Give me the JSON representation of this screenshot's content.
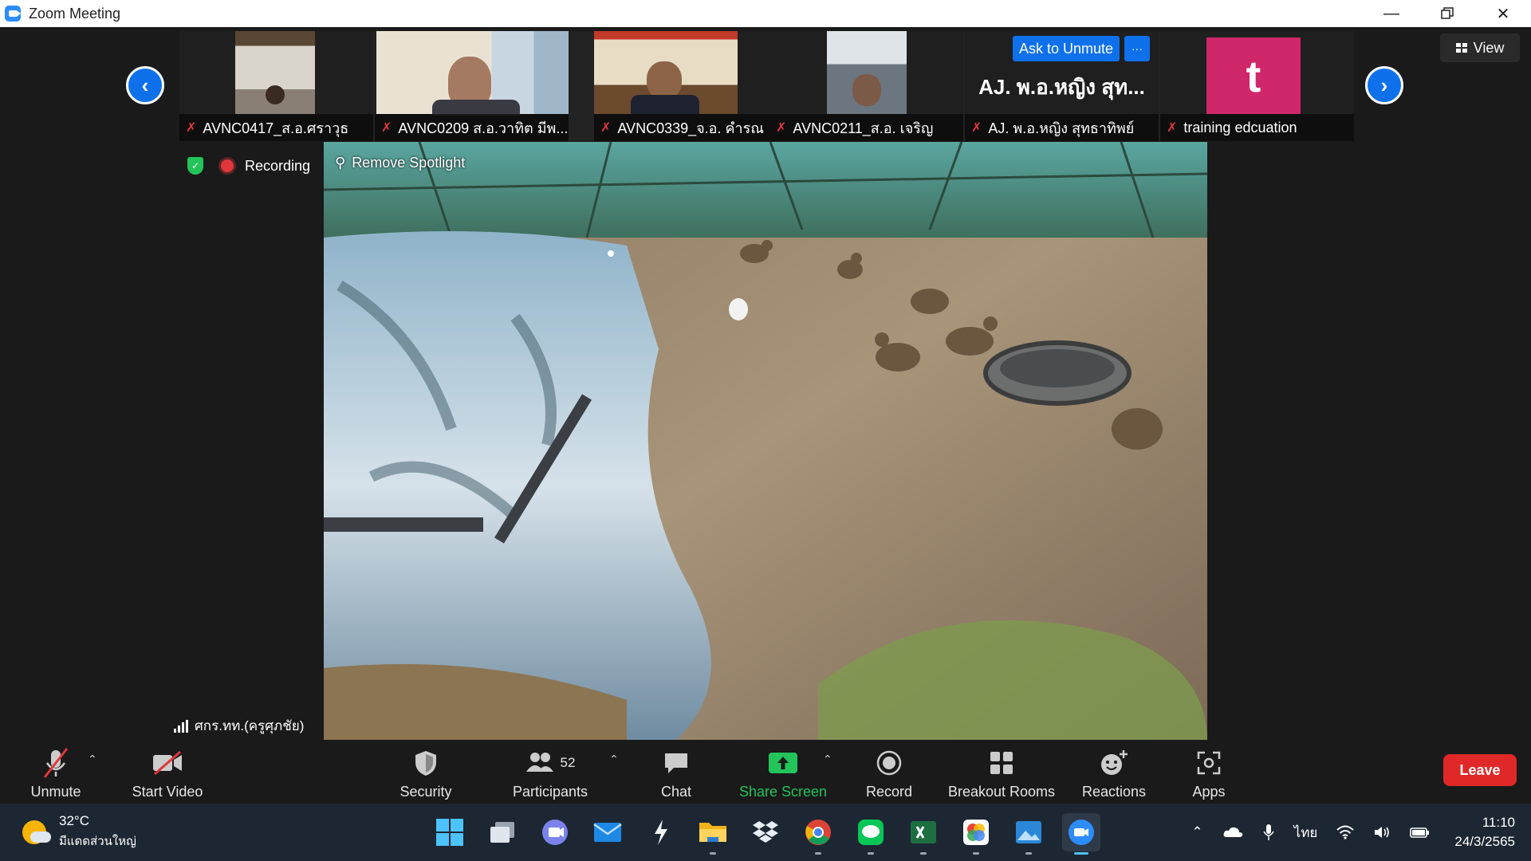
{
  "window": {
    "title": "Zoom Meeting"
  },
  "gallery": {
    "participants": [
      {
        "name": "AVNC0417_ส.อ.ศราวุธ"
      },
      {
        "name": "AVNC0209 ส.อ.วาทิต มีพ..."
      },
      {
        "name": "AVNC0339_จ.อ. คำรณ"
      },
      {
        "name": "AVNC0211_ส.อ. เจริญ"
      },
      {
        "name": "AJ. พ.อ.หญิง สุทธาทิพย์",
        "big_label": "AJ. พ.อ.หญิง สุท...",
        "action": "Ask to Unmute",
        "more": "···"
      },
      {
        "name": "training edcuation",
        "initial": "t"
      }
    ],
    "view_label": "View"
  },
  "status": {
    "recording_label": "Recording"
  },
  "main_video": {
    "spotlight_label": "Remove Spotlight",
    "speaker_name": "ศกร.ทท.(ครูศุภชัย)"
  },
  "toolbar": {
    "unmute": "Unmute",
    "start_video": "Start Video",
    "security": "Security",
    "participants": "Participants",
    "participants_count": "52",
    "chat": "Chat",
    "share_screen": "Share Screen",
    "record": "Record",
    "breakout_rooms": "Breakout Rooms",
    "reactions": "Reactions",
    "apps": "Apps",
    "leave": "Leave"
  },
  "taskbar": {
    "weather_temp": "32°C",
    "weather_desc": "มีแดดส่วนใหญ่",
    "language": "ไทย",
    "time": "11:10",
    "date": "24/3/2565"
  },
  "colors": {
    "accent": "#0e71eb",
    "leave": "#e02828",
    "share": "#23c45a",
    "avatar": "#d0276a"
  }
}
